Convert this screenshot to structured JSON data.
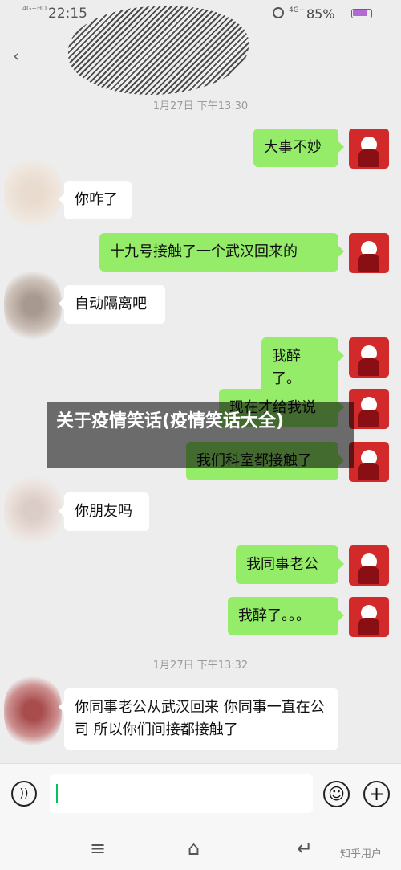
{
  "status_bar": {
    "time": "22:15",
    "network_left": "4G+HD",
    "network_right": "4G+",
    "battery": "85%",
    "battery_level": 0.85
  },
  "timestamps": [
    "1月27日 下午13:30",
    "1月27日 下午13:32"
  ],
  "messages": [
    {
      "side": "me",
      "text": "大事不妙"
    },
    {
      "side": "other",
      "text": "你咋了"
    },
    {
      "side": "me",
      "text": "十九号接触了一个武汉回来的"
    },
    {
      "side": "other",
      "text": "自动隔离吧"
    },
    {
      "side": "me",
      "text": "我醉了。"
    },
    {
      "side": "me",
      "text": "现在才给我说"
    },
    {
      "side": "me",
      "text": "我们科室都接触了"
    },
    {
      "side": "other",
      "text": "你朋友吗"
    },
    {
      "side": "me",
      "text": "我同事老公"
    },
    {
      "side": "me",
      "text": "我醉了。。。"
    },
    {
      "side": "other",
      "text": "你同事老公从武汉回来 你同事一直在公司 所以你们间接都接触了"
    }
  ],
  "overlay_title": "关于疫情笑话(疫情笑话大全)",
  "colors": {
    "my_bubble": "#95ec69",
    "other_bubble": "#ffffff",
    "background": "#ededed",
    "overlay": "#000000"
  },
  "icons": {
    "back": "chevron-left-icon",
    "voice": "voice-icon",
    "emoji": "emoji-icon",
    "plus": "plus-icon",
    "menu": "menu-icon",
    "home": "home-icon",
    "return": "return-icon"
  },
  "watermark": "知乎用户"
}
